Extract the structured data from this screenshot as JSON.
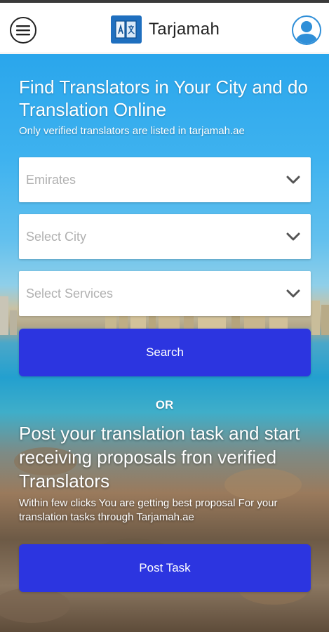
{
  "app": {
    "name": "Tarjamah"
  },
  "hero": {
    "headline": "Find Translators in Your City and do Translation Online",
    "subline": "Only verified translators are listed in tarjamah.ae"
  },
  "filters": {
    "country_placeholder": "Emirates",
    "city_placeholder": "Select City",
    "services_placeholder": "Select Services"
  },
  "search_label": "Search",
  "or_label": "OR",
  "post": {
    "title": "Post your translation task and start receiving proposals fron verified Translators",
    "description": "Within few clicks You are getting best proposal For your translation tasks through Tarjamah.ae",
    "button_label": "Post Task"
  },
  "icons": {
    "menu": "hamburger-menu-icon",
    "logo": "translate-book-icon",
    "profile": "user-profile-icon",
    "dropdown": "chevron-down-icon"
  },
  "colors": {
    "primary_button": "#2c35e0",
    "logo_blue": "#1f6fbf",
    "avatar_blue": "#2f8fd8"
  }
}
